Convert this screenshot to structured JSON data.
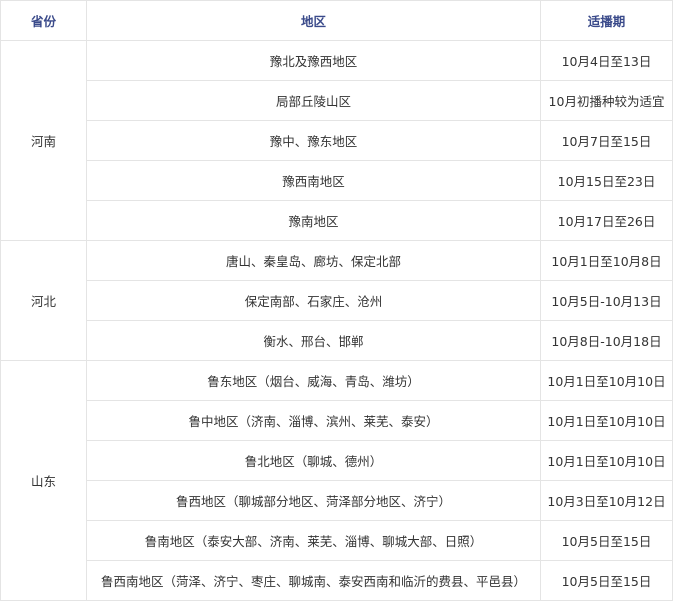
{
  "headers": [
    "省份",
    "地区",
    "适播期"
  ],
  "groups": [
    {
      "province": "河南",
      "rows": [
        {
          "region": "豫北及豫西地区",
          "period": "10月4日至13日"
        },
        {
          "region": "局部丘陵山区",
          "period": "10月初播种较为适宜"
        },
        {
          "region": "豫中、豫东地区",
          "period": "10月7日至15日"
        },
        {
          "region": "豫西南地区",
          "period": "10月15日至23日"
        },
        {
          "region": "豫南地区",
          "period": "10月17日至26日"
        }
      ]
    },
    {
      "province": "河北",
      "rows": [
        {
          "region": "唐山、秦皇岛、廊坊、保定北部",
          "period": "10月1日至10月8日"
        },
        {
          "region": "保定南部、石家庄、沧州",
          "period": "10月5日-10月13日"
        },
        {
          "region": "衡水、邢台、邯郸",
          "period": "10月8日-10月18日"
        }
      ]
    },
    {
      "province": "山东",
      "rows": [
        {
          "region": "鲁东地区（烟台、威海、青岛、潍坊）",
          "period": "10月1日至10月10日"
        },
        {
          "region": "鲁中地区（济南、淄博、滨州、莱芜、泰安）",
          "period": "10月1日至10月10日"
        },
        {
          "region": "鲁北地区（聊城、德州）",
          "period": "10月1日至10月10日"
        },
        {
          "region": "鲁西地区（聊城部分地区、菏泽部分地区、济宁）",
          "period": "10月3日至10月12日"
        },
        {
          "region": "鲁南地区（泰安大部、济南、莱芜、淄博、聊城大部、日照）",
          "period": "10月5日至15日"
        },
        {
          "region": "鲁西南地区（菏泽、济宁、枣庄、聊城南、泰安西南和临沂的费县、平邑县）",
          "period": "10月5日至15日"
        }
      ]
    }
  ]
}
